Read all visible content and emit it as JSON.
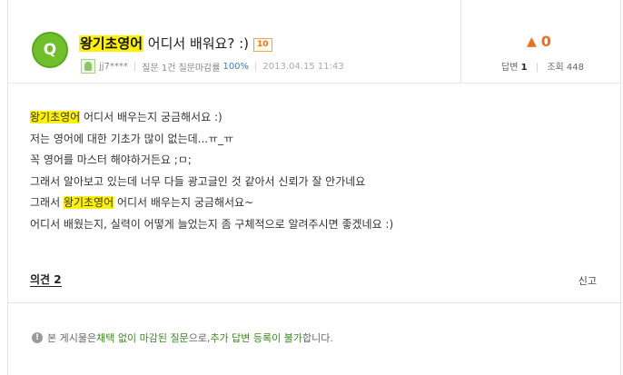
{
  "question": {
    "badge": "Q",
    "title_highlight": "왕기초영어",
    "title_rest": " 어디서 배워요? :)",
    "level": "10",
    "user": "jj7****",
    "meta_count": "질문 1건",
    "meta_rate_label": "질문마감률",
    "meta_rate": "100%",
    "date": "2013.04.15 11:43"
  },
  "side": {
    "recommend_icon": "thumb-up-icon",
    "recommend_count": "0",
    "answers_label": "답변",
    "answers_count": "1",
    "views_label": "조회",
    "views_count": "448"
  },
  "body": {
    "line1_hl": "왕기초영어",
    "line1_rest": " 어디서 배우는지 궁금해서요 :)",
    "line2": "저는 영어에 대한 기초가 많이 없는데...ㅠ_ㅠ",
    "line3": "꼭 영어를 마스터 해야하거든요 ;ㅁ;",
    "line4": "그래서 알아보고 있는데 너무 다들 광고글인 것 같아서 신뢰가 잘 안가네요",
    "line5_pre": "그래서 ",
    "line5_hl": "왕기초영어",
    "line5_rest": " 어디서 배우는지 궁금해서요~",
    "line6": "어디서 배웠는지, 실력이 어떻게 늘었는지 좀 구체적으로 알려주시면 좋겠네요 :)"
  },
  "footer": {
    "opinions": "의견 2",
    "report": "신고",
    "notice_icon": "info-icon",
    "notice_pre": "본 게시물은 ",
    "notice_g1": "채택 없이 마감된 질문",
    "notice_mid": "으로, ",
    "notice_g2": "추가 답변 등록이 불가",
    "notice_post": "합니다."
  }
}
